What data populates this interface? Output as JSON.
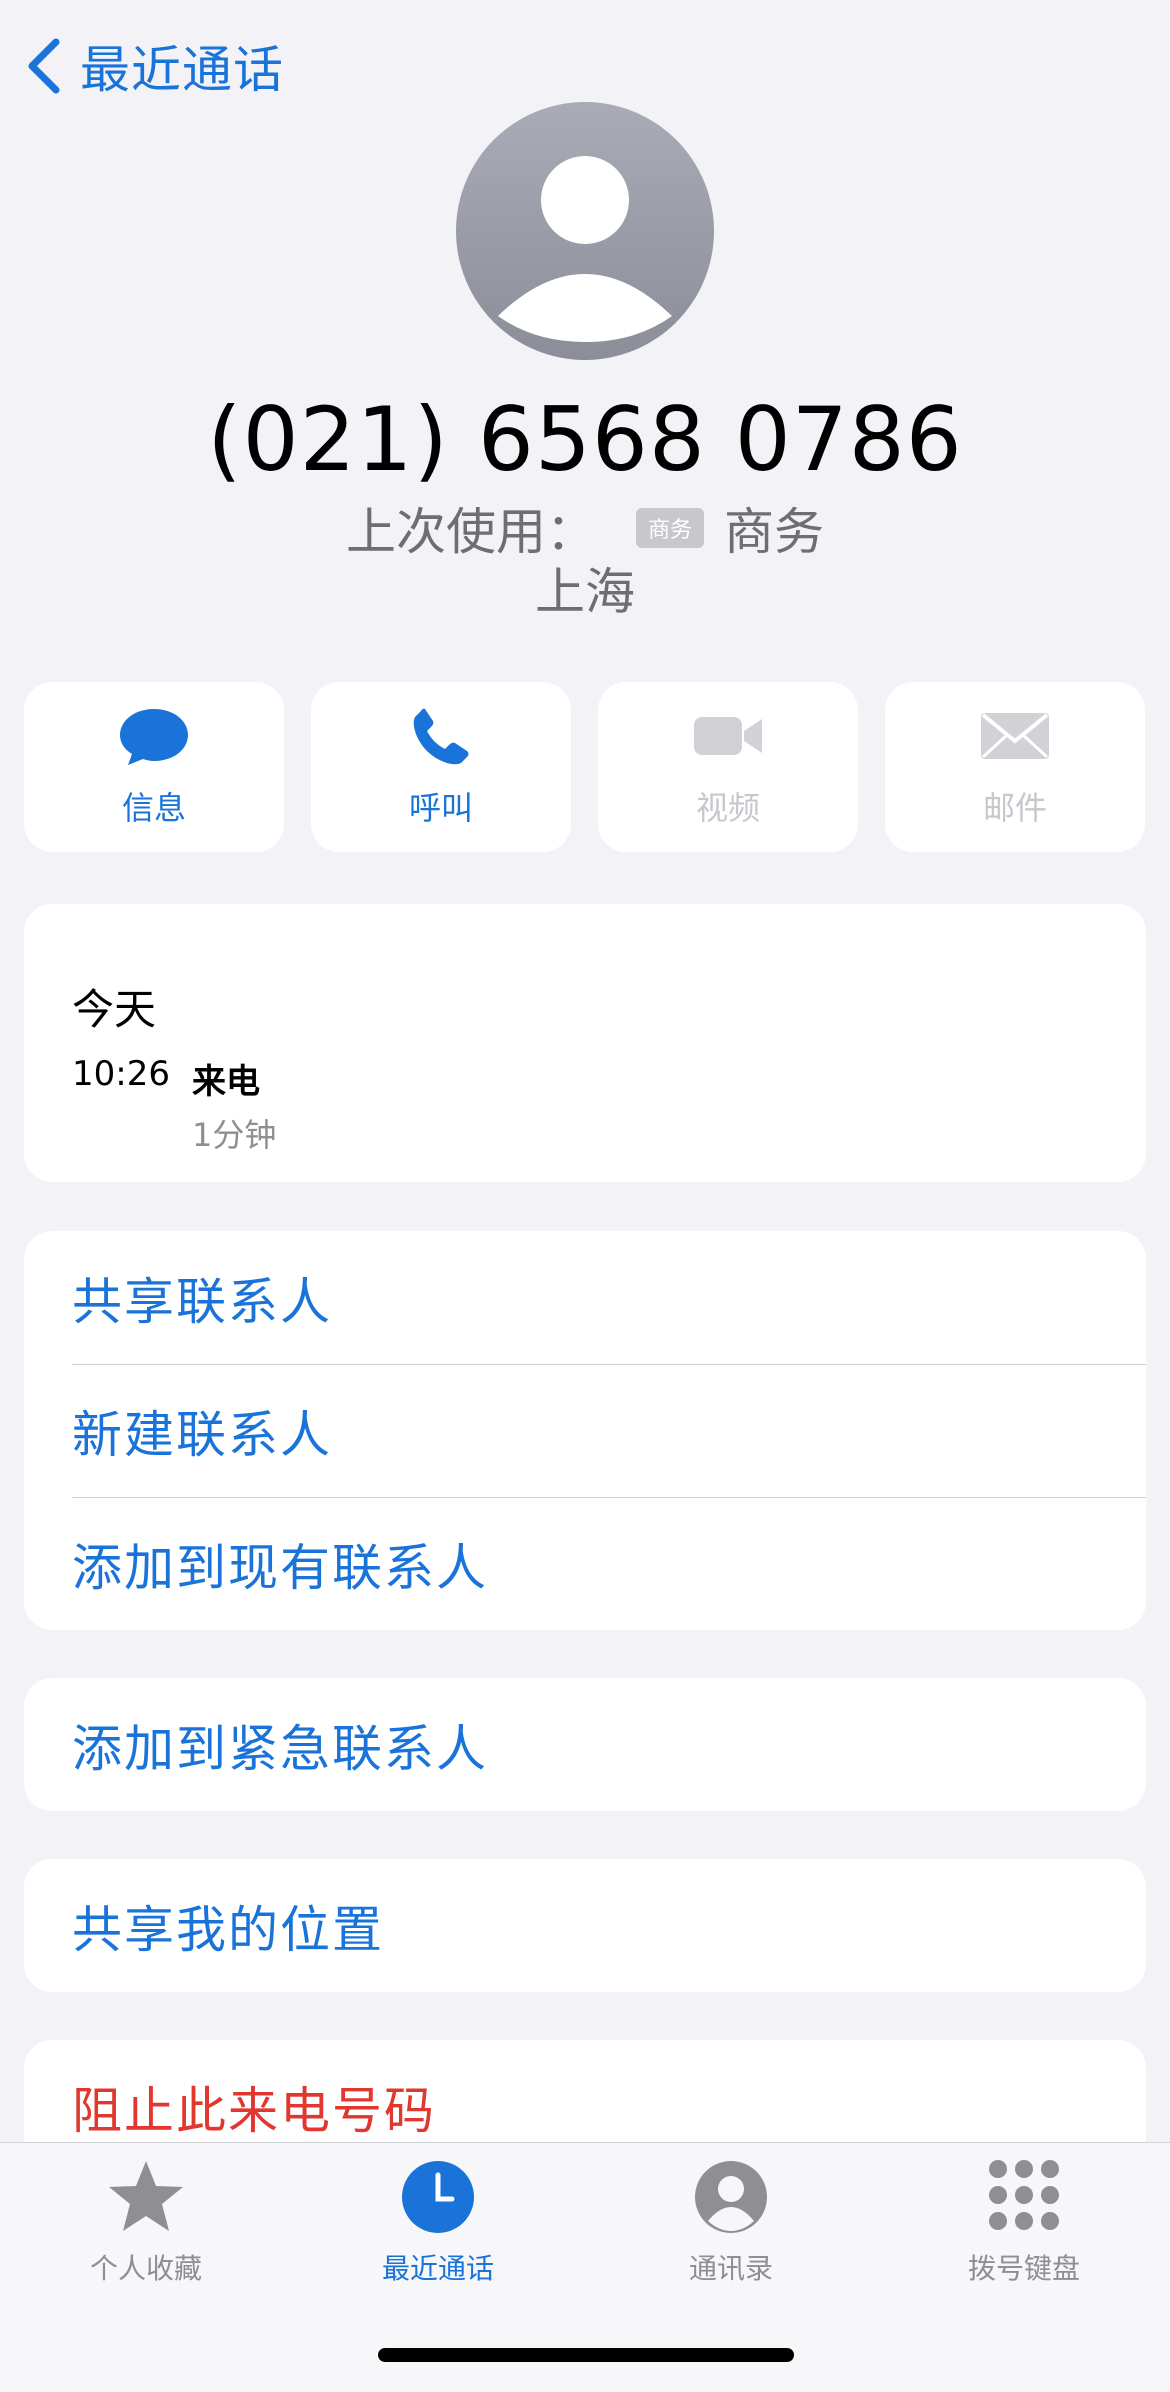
{
  "nav": {
    "back_label": "最近通话",
    "back_icon": "chevron-left-icon"
  },
  "contact": {
    "phone": "(021) 6568 0786",
    "last_used_label": "上次使用：",
    "last_used_tag": "商务",
    "last_used_value": "商务",
    "location": "上海",
    "avatar_icon": "person-placeholder-icon"
  },
  "actions": [
    {
      "label": "信息",
      "icon": "message-bubble-icon",
      "enabled": true
    },
    {
      "label": "呼叫",
      "icon": "phone-icon",
      "enabled": true
    },
    {
      "label": "视频",
      "icon": "video-camera-icon",
      "enabled": false
    },
    {
      "label": "邮件",
      "icon": "mail-icon",
      "enabled": false
    }
  ],
  "call_log": {
    "day": "今天",
    "time": "10:26",
    "type": "来电",
    "duration": "1分钟"
  },
  "contact_options": [
    "共享联系人",
    "新建联系人",
    "添加到现有联系人"
  ],
  "emergency_option": "添加到紧急联系人",
  "share_location_option": "共享我的位置",
  "block_option": "阻止此来电号码",
  "tabbar": {
    "tabs": [
      {
        "label": "个人收藏",
        "icon": "star-icon",
        "active": false
      },
      {
        "label": "最近通话",
        "icon": "clock-icon",
        "active": true
      },
      {
        "label": "通讯录",
        "icon": "person-circle-icon",
        "active": false
      },
      {
        "label": "拨号键盘",
        "icon": "keypad-icon",
        "active": false
      }
    ]
  },
  "colors": {
    "accent": "#1a73d9",
    "destructive": "#e0382f",
    "background": "#f2f2f7"
  }
}
